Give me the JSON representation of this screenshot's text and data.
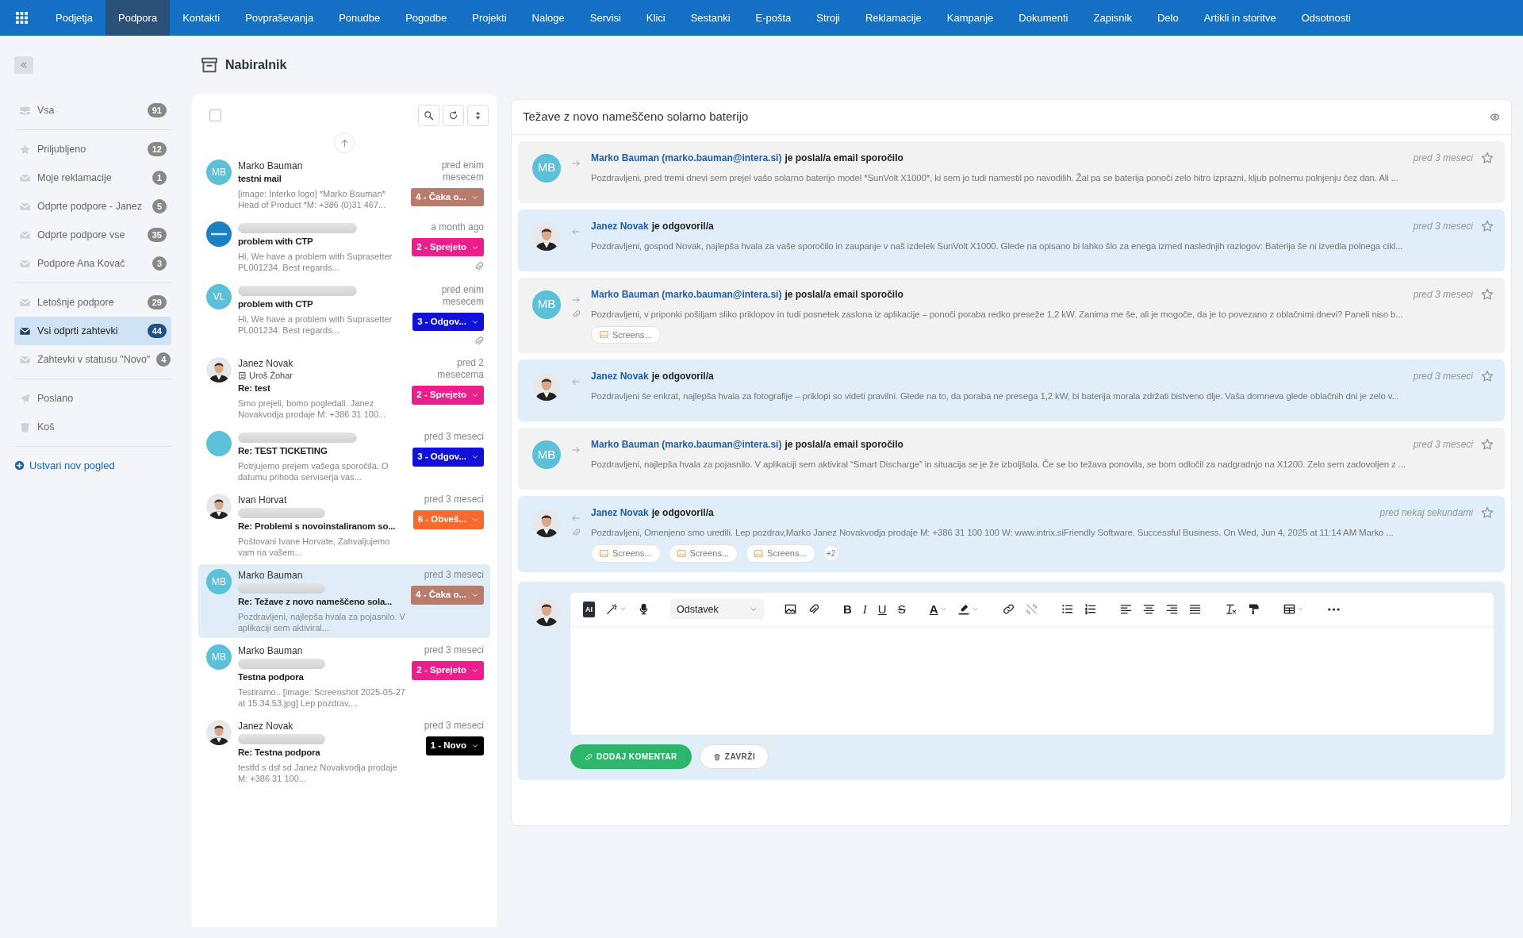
{
  "top_nav": {
    "items": [
      {
        "label": "Podjetja",
        "selected": false
      },
      {
        "label": "Podpora",
        "selected": true
      },
      {
        "label": "Kontakti",
        "selected": false
      },
      {
        "label": "Povpraševanja",
        "selected": false
      },
      {
        "label": "Ponudbe",
        "selected": false
      },
      {
        "label": "Pogodbe",
        "selected": false
      },
      {
        "label": "Projekti",
        "selected": false
      },
      {
        "label": "Naloge",
        "selected": false
      },
      {
        "label": "Servisi",
        "selected": false
      },
      {
        "label": "Klici",
        "selected": false
      },
      {
        "label": "Sestanki",
        "selected": false
      },
      {
        "label": "E-pošta",
        "selected": false
      },
      {
        "label": "Stroji",
        "selected": false
      },
      {
        "label": "Reklamacije",
        "selected": false
      },
      {
        "label": "Kampanje",
        "selected": false
      },
      {
        "label": "Dokumenti",
        "selected": false
      },
      {
        "label": "Zapisnik",
        "selected": false
      },
      {
        "label": "Delo",
        "selected": false
      },
      {
        "label": "Artikli in storitve",
        "selected": false
      },
      {
        "label": "Odsotnosti",
        "selected": false
      }
    ]
  },
  "sidebar": {
    "groups": [
      {
        "items": [
          {
            "label": "Vsa",
            "count": "91",
            "selected": false
          }
        ]
      },
      {
        "items": [
          {
            "label": "Priljubljeno",
            "count": "12",
            "selected": false
          },
          {
            "label": "Moje reklamacije",
            "count": "1",
            "selected": false
          },
          {
            "label": "Odprte podpore - Janez",
            "count": "5",
            "selected": false
          },
          {
            "label": "Odprte podpore vse",
            "count": "35",
            "selected": false
          },
          {
            "label": "Podpore Ana Kovač",
            "count": "3",
            "selected": false
          }
        ]
      },
      {
        "items": [
          {
            "label": "Letošnje podpore",
            "count": "29",
            "selected": false
          },
          {
            "label": "Vsi odprti zahtevki",
            "count": "44",
            "selected": true
          },
          {
            "label": "Zahtevki v statusu \"Novo\"",
            "count": "4",
            "selected": false
          }
        ]
      },
      {
        "items": [
          {
            "label": "Poslano",
            "selected": false
          },
          {
            "label": "Koš",
            "selected": false
          }
        ]
      }
    ],
    "create_view": "Ustvari nov pogled"
  },
  "header": {
    "title": "Nabiralnik"
  },
  "message_list": {
    "select_all": {
      "checked": false
    },
    "items": [
      {
        "avatar": {
          "kind": "initials",
          "text": "MB",
          "color": "#5cc0d9"
        },
        "sender": "Marko Bauman",
        "redacted_name": false,
        "redacted_line": false,
        "subject": "testni mail",
        "preview": "[image: Interko logo] *Marko Bauman* Head of Product *M: +386 (0)31 467...",
        "time": "pred enim mesecem",
        "status": {
          "label": "4 - Čaka o...",
          "color": "#b97b6b"
        },
        "attachment": false,
        "selected": false
      },
      {
        "avatar": {
          "kind": "logo"
        },
        "redacted_name": true,
        "redacted_line": false,
        "subject": "problem with CTP",
        "preview": "Hi, We have a problem with Suprasetter PL001234. Best regards...",
        "time": "a month ago",
        "status": {
          "label": "2 - Sprejeto",
          "color": "#ec1e8c"
        },
        "attachment": true,
        "selected": false
      },
      {
        "avatar": {
          "kind": "initials",
          "text": "VL",
          "color": "#5cc0d9"
        },
        "redacted_name": true,
        "redacted_line": false,
        "subject": "problem with CTP",
        "preview": "Hi, We have a problem with Suprasetter PL001234. Best regards...",
        "time": "pred enim mesecem",
        "status": {
          "label": "3 - Odgov...",
          "color": "#1010d8"
        },
        "attachment": true,
        "selected": false
      },
      {
        "avatar": {
          "kind": "photo"
        },
        "sender": "Janez Novak",
        "company": "Uroš Žohar",
        "redacted_name": false,
        "redacted_line": false,
        "subject": "Re: test",
        "preview": "Smo prejeli, bomo pogledali. Janez Novakvodja prodaje M: +386 31 100...",
        "time": "pred 2 mesecema",
        "status": {
          "label": "2 - Sprejeto",
          "color": "#ec1e8c"
        },
        "attachment": false,
        "selected": false
      },
      {
        "avatar": {
          "kind": "blank",
          "color": "#5cc0d9"
        },
        "redacted_name": true,
        "redacted_line": false,
        "subject": "Re: TEST TICKETING",
        "preview": "Potrjujemo prejem vašega sporočila. O datumu prihoda serviserja vas...",
        "time": "pred 3 meseci",
        "status": {
          "label": "3 - Odgov...",
          "color": "#1010d8"
        },
        "attachment": false,
        "selected": false
      },
      {
        "avatar": {
          "kind": "photo"
        },
        "sender": "Ivan Horvat",
        "redacted_name": false,
        "redacted_line": true,
        "subject": "Re: Problemi s novoinstaliranom so...",
        "preview": "Poštovani Ivane Horvate, Zahvaljujemo vam na vašem...",
        "time": "pred 3 meseci",
        "status": {
          "label": "6 - Obveš...",
          "color": "#f7692c"
        },
        "attachment": false,
        "selected": false
      },
      {
        "avatar": {
          "kind": "initials",
          "text": "MB",
          "color": "#5cc0d9"
        },
        "sender": "Marko Bauman",
        "redacted_name": false,
        "redacted_line": true,
        "subject": "Re: Težave z novo nameščeno sola...",
        "preview": "Pozdravljeni, najlepša hvala za pojasnilo. V aplikaciji sem aktiviral...",
        "time": "pred 3 meseci",
        "status": {
          "label": "4 - Čaka o...",
          "color": "#b97b6b"
        },
        "attachment": false,
        "selected": true
      },
      {
        "avatar": {
          "kind": "initials",
          "text": "MB",
          "color": "#5cc0d9"
        },
        "sender": "Marko Bauman",
        "redacted_name": false,
        "redacted_line": true,
        "subject": "Testna podpora",
        "preview": "Testiramo.. [image: Screenshot 2025-05-27 at 15.34.53.jpg] Lep pozdrav,...",
        "time": "pred 3 meseci",
        "status": {
          "label": "2 - Sprejeto",
          "color": "#ec1e8c"
        },
        "attachment": false,
        "selected": false
      },
      {
        "avatar": {
          "kind": "photo"
        },
        "sender": "Janez Novak",
        "redacted_name": false,
        "redacted_line": true,
        "subject": "Re: Testna podpora",
        "preview": "testfd s dsf sd  Janez Novakvodja prodaje M: +386 31 100...",
        "time": "pred 3 meseci",
        "status": {
          "label": "1 - Novo",
          "color": "#000000"
        },
        "attachment": false,
        "selected": false
      }
    ]
  },
  "thread": {
    "title": "Težave z novo nameščeno solarno baterijo",
    "messages": [
      {
        "kind": "incoming",
        "avatar": {
          "kind": "initials",
          "text": "MB",
          "color": "#5cc0d9"
        },
        "author": "Marko Bauman (marko.bauman@intera.si)",
        "action": "je poslal/a email sporočilo",
        "time": "pred 3 meseci",
        "starred": false,
        "attachment": false,
        "preview": "Pozdravljeni, pred tremi dnevi sem prejel vašo solarno baterijo model *SunVolt X1000*, ki sem jo tudi namestil po navodilih. Žal pa se baterija ponoči zelo hitro izprazni, kljub polnemu polnjenju čez dan. Ali ..."
      },
      {
        "kind": "reply",
        "avatar": {
          "kind": "photo"
        },
        "author": "Janez Novak",
        "action": "je odgovoril/a",
        "time": "pred 3 meseci",
        "starred": false,
        "attachment": false,
        "preview": "Pozdravljeni, gospod Novak, najlepša hvala za vaše sporočilo in zaupanje v naš izdelek SunVolt X1000. Glede na opisano bi lahko šlo za enega izmed naslednjih razlogov: Baterija še ni izvedla polnega cikl..."
      },
      {
        "kind": "incoming",
        "avatar": {
          "kind": "initials",
          "text": "MB",
          "color": "#5cc0d9"
        },
        "author": "Marko Bauman (marko.bauman@intera.si)",
        "action": "je poslal/a email sporočilo",
        "time": "pred 3 meseci",
        "starred": false,
        "attachment": true,
        "preview": "Pozdravljeni, v priponki pošiljam sliko priklopov in tudi posnetek zaslona iz aplikacije – ponoči poraba redko preseže 1,2 kW. Zanima me še, ali je mogoče, da je to povezano z oblačnimi dnevi? Paneli niso b...",
        "files": [
          "Screens..."
        ]
      },
      {
        "kind": "reply",
        "avatar": {
          "kind": "photo"
        },
        "author": "Janez Novak",
        "action": "je odgovoril/a",
        "time": "pred 3 meseci",
        "starred": false,
        "attachment": false,
        "preview": "Pozdravljeni še enkrat, najlepša hvala za fotografije – priklopi so videti pravilni. Glede na to, da poraba ne presega 1,2 kW, bi baterija morala zdržati bistveno dlje. Vaša domneva glede oblačnih dni je zelo v..."
      },
      {
        "kind": "incoming",
        "avatar": {
          "kind": "initials",
          "text": "MB",
          "color": "#5cc0d9"
        },
        "author": "Marko Bauman (marko.bauman@intera.si)",
        "action": "je poslal/a email sporočilo",
        "time": "pred 3 meseci",
        "starred": false,
        "attachment": false,
        "preview": "Pozdravljeni, najlepša hvala za pojasnilo. V aplikaciji sem aktiviral “Smart Discharge” in situacija se je že izboljšala. Če se bo težava ponovila, se bom odločil za nadgradnjo na X1200. Zelo sem zadovoljen z ..."
      },
      {
        "kind": "reply",
        "avatar": {
          "kind": "photo"
        },
        "author": "Janez Novak",
        "action": "je odgovoril/a",
        "time": "pred nekaj sekundami",
        "starred": false,
        "attachment": true,
        "preview": "Pozdravljeni, Omenjeno smo uredili. Lep pozdrav,Marko   Janez Novakvodja prodaje M: +386 31 100 100 W: www.intrix.siFriendly Software. Successful Business.      On Wed, Jun 4, 2025 at 11:14 AM Marko ...",
        "files": [
          "Screens...",
          "Screens...",
          "Screens..."
        ],
        "more": "+2"
      }
    ],
    "composer": {
      "toolbar": [
        {
          "kind": "ai",
          "label": "AI"
        },
        {
          "kind": "wand"
        },
        {
          "kind": "mic"
        },
        {
          "kind": "select",
          "label": "Odstavek"
        },
        {
          "kind": "image"
        },
        {
          "kind": "clip"
        },
        {
          "kind": "bold",
          "label": "B"
        },
        {
          "kind": "italic",
          "label": "I"
        },
        {
          "kind": "underline",
          "label": "U"
        },
        {
          "kind": "strike",
          "label": "S"
        },
        {
          "kind": "text-color",
          "label": "A"
        },
        {
          "kind": "highlight"
        },
        {
          "kind": "link"
        },
        {
          "kind": "unlink"
        },
        {
          "kind": "bullets"
        },
        {
          "kind": "numbers"
        },
        {
          "kind": "align-left"
        },
        {
          "kind": "align-center"
        },
        {
          "kind": "align-right"
        },
        {
          "kind": "justify"
        },
        {
          "kind": "clear-format"
        },
        {
          "kind": "paint"
        },
        {
          "kind": "table"
        },
        {
          "kind": "more"
        }
      ],
      "buttons": [
        {
          "kind": "primary",
          "label": "DODAJ KOMENTAR"
        },
        {
          "kind": "discard",
          "label": "ZAVRŽI"
        }
      ]
    }
  }
}
